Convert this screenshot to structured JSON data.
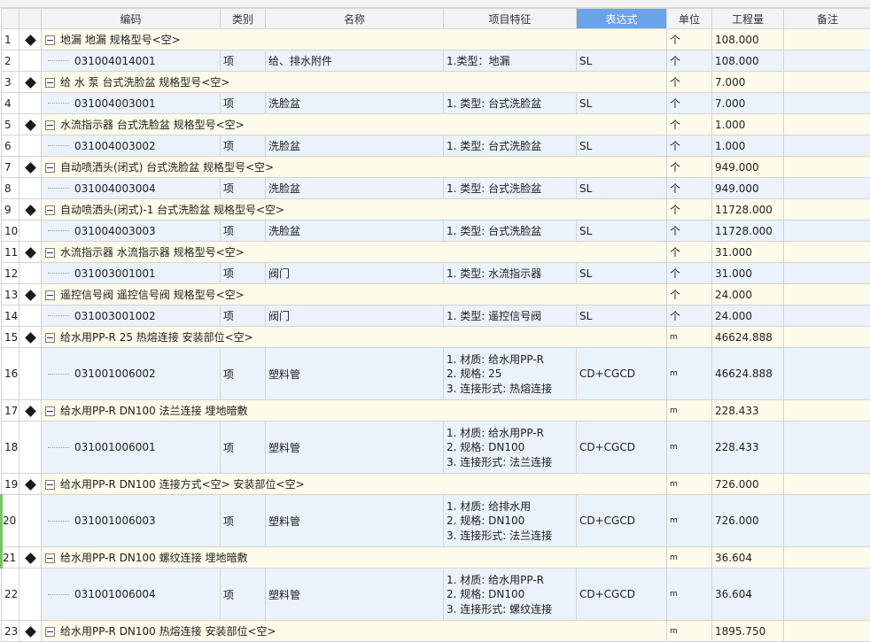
{
  "columns": [
    "",
    "",
    "编码",
    "类别",
    "名称",
    "项目特征",
    "表达式",
    "单位",
    "工程量",
    "备注"
  ],
  "active_column": "表达式",
  "rows": [
    {
      "num": "1",
      "kind": "group",
      "code": "地漏 地漏 规格型号<空>",
      "unit": "个",
      "qty": "108.000"
    },
    {
      "num": "2",
      "kind": "item",
      "code": "031004014001",
      "type": "项",
      "name": "给、排水附件",
      "features": [
        "1.类型：地漏"
      ],
      "expr": "SL",
      "unit": "个",
      "qty": "108.000"
    },
    {
      "num": "3",
      "kind": "group",
      "code": "给 水 泵 台式洗脸盆 规格型号<空>",
      "unit": "个",
      "qty": "7.000"
    },
    {
      "num": "4",
      "kind": "item",
      "code": "031004003001",
      "type": "项",
      "name": "洗脸盆",
      "features": [
        "1. 类型: 台式洗脸盆"
      ],
      "expr": "SL",
      "unit": "个",
      "qty": "7.000"
    },
    {
      "num": "5",
      "kind": "group",
      "code": "水流指示器 台式洗脸盆 规格型号<空>",
      "unit": "个",
      "qty": "1.000"
    },
    {
      "num": "6",
      "kind": "item",
      "code": "031004003002",
      "type": "项",
      "name": "洗脸盆",
      "features": [
        "1. 类型: 台式洗脸盆"
      ],
      "expr": "SL",
      "unit": "个",
      "qty": "1.000"
    },
    {
      "num": "7",
      "kind": "group",
      "code": "自动喷洒头(闭式) 台式洗脸盆 规格型号<空>",
      "unit": "个",
      "qty": "949.000"
    },
    {
      "num": "8",
      "kind": "item",
      "code": "031004003004",
      "type": "项",
      "name": "洗脸盆",
      "features": [
        "1. 类型: 台式洗脸盆"
      ],
      "expr": "SL",
      "unit": "个",
      "qty": "949.000"
    },
    {
      "num": "9",
      "kind": "group",
      "code": "自动喷洒头(闭式)-1 台式洗脸盆 规格型号<空>",
      "unit": "个",
      "qty": "11728.000"
    },
    {
      "num": "10",
      "kind": "item",
      "code": "031004003003",
      "type": "项",
      "name": "洗脸盆",
      "features": [
        "1. 类型: 台式洗脸盆"
      ],
      "expr": "SL",
      "unit": "个",
      "qty": "11728.000"
    },
    {
      "num": "11",
      "kind": "group",
      "code": "水流指示器 水流指示器 规格型号<空>",
      "unit": "个",
      "qty": "31.000"
    },
    {
      "num": "12",
      "kind": "item",
      "code": "031003001001",
      "type": "项",
      "name": "阀门",
      "features": [
        "1. 类型: 水流指示器"
      ],
      "expr": "SL",
      "unit": "个",
      "qty": "31.000"
    },
    {
      "num": "13",
      "kind": "group",
      "code": "遥控信号阀 遥控信号阀 规格型号<空>",
      "unit": "个",
      "qty": "24.000"
    },
    {
      "num": "14",
      "kind": "item",
      "code": "031003001002",
      "type": "项",
      "name": "阀门",
      "features": [
        "1. 类型: 遥控信号阀"
      ],
      "expr": "SL",
      "unit": "个",
      "qty": "24.000"
    },
    {
      "num": "15",
      "kind": "group",
      "code": "给水用PP-R 25 热熔连接 安装部位<空>",
      "unit": "m",
      "qty": "46624.888"
    },
    {
      "num": "16",
      "kind": "item",
      "tall": true,
      "code": "031001006002",
      "type": "项",
      "name": "塑料管",
      "features": [
        "1. 材质: 给水用PP-R",
        "2. 规格: 25",
        "3. 连接形式: 热熔连接"
      ],
      "expr": "CD+CGCD",
      "unit": "m",
      "qty": "46624.888"
    },
    {
      "num": "17",
      "kind": "group",
      "code": "给水用PP-R DN100 法兰连接 埋地暗敷",
      "unit": "m",
      "qty": "228.433"
    },
    {
      "num": "18",
      "kind": "item",
      "tall": true,
      "code": "031001006001",
      "type": "项",
      "name": "塑料管",
      "features": [
        "1. 材质: 给水用PP-R",
        "2. 规格: DN100",
        "3. 连接形式: 法兰连接"
      ],
      "expr": "CD+CGCD",
      "unit": "m",
      "qty": "228.433"
    },
    {
      "num": "19",
      "kind": "group",
      "code": "给水用PP-R DN100 连接方式<空> 安装部位<空>",
      "unit": "m",
      "qty": "726.000"
    },
    {
      "num": "20",
      "kind": "item",
      "tall": true,
      "green": true,
      "code": "031001006003",
      "type": "项",
      "name": "塑料管",
      "features": [
        "1. 材质: 给排水用",
        "2. 规格: DN100",
        "3. 连接形式: 法兰连接"
      ],
      "expr": "CD+CGCD",
      "unit": "m",
      "qty": "726.000"
    },
    {
      "num": "21",
      "kind": "group",
      "green": true,
      "code": "给水用PP-R DN100 螺纹连接 埋地暗敷",
      "unit": "m",
      "qty": "36.604"
    },
    {
      "num": "22",
      "kind": "item",
      "tall": true,
      "code": "031001006004",
      "type": "项",
      "name": "塑料管",
      "features": [
        "1. 材质: 给水用PP-R",
        "2. 规格: DN100",
        "3. 连接形式: 螺纹连接"
      ],
      "expr": "CD+CGCD",
      "unit": "m",
      "qty": "36.604"
    },
    {
      "num": "23",
      "kind": "group",
      "code": "给水用PP-R DN100 热熔连接 安装部位<空>",
      "unit": "m",
      "qty": "1895.750"
    }
  ],
  "icons": {
    "group_marker": "diamond-icon",
    "collapse": "collapse-minus-icon"
  }
}
